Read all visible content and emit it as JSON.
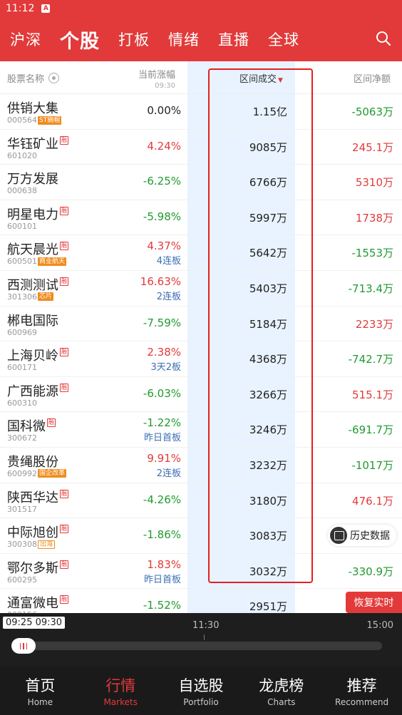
{
  "status_bar": {
    "time": "11:12",
    "badge": "A"
  },
  "top_nav": {
    "tabs": [
      {
        "label": "沪深",
        "active": false
      },
      {
        "label": "个股",
        "active": true
      },
      {
        "label": "打板",
        "active": false
      },
      {
        "label": "情绪",
        "active": false
      },
      {
        "label": "直播",
        "active": false
      },
      {
        "label": "全球",
        "active": false
      }
    ]
  },
  "columns": {
    "name": "股票名称",
    "change": "当前涨幅",
    "change_time": "09:30",
    "volume": "区间成交",
    "net": "区间净额"
  },
  "rows": [
    {
      "name": "供销大集",
      "code": "000564",
      "rong": false,
      "tag": "ST摘帽",
      "tag_style": "solid",
      "change": "0.00%",
      "change_color": "black",
      "change_sub": "",
      "volume": "1.15亿",
      "net": "-5063万",
      "net_color": "green"
    },
    {
      "name": "华钰矿业",
      "code": "601020",
      "rong": true,
      "tag": "",
      "tag_style": "",
      "change": "4.24%",
      "change_color": "red",
      "change_sub": "",
      "volume": "9085万",
      "net": "245.1万",
      "net_color": "red"
    },
    {
      "name": "万方发展",
      "code": "000638",
      "rong": false,
      "tag": "",
      "tag_style": "",
      "change": "-6.25%",
      "change_color": "green",
      "change_sub": "",
      "volume": "6766万",
      "net": "5310万",
      "net_color": "red"
    },
    {
      "name": "明星电力",
      "code": "600101",
      "rong": true,
      "tag": "",
      "tag_style": "",
      "change": "-5.98%",
      "change_color": "green",
      "change_sub": "",
      "volume": "5997万",
      "net": "1738万",
      "net_color": "red"
    },
    {
      "name": "航天晨光",
      "code": "600501",
      "rong": true,
      "tag": "商业航天",
      "tag_style": "solid",
      "change": "4.37%",
      "change_color": "red",
      "change_sub": "4连板",
      "volume": "5642万",
      "net": "-1553万",
      "net_color": "green"
    },
    {
      "name": "西测测试",
      "code": "301306",
      "rong": true,
      "tag": "芯片",
      "tag_style": "solid",
      "change": "16.63%",
      "change_color": "red",
      "change_sub": "2连板",
      "volume": "5403万",
      "net": "-713.4万",
      "net_color": "green"
    },
    {
      "name": "郴电国际",
      "code": "600969",
      "rong": false,
      "tag": "",
      "tag_style": "",
      "change": "-7.59%",
      "change_color": "green",
      "change_sub": "",
      "volume": "5184万",
      "net": "2233万",
      "net_color": "red"
    },
    {
      "name": "上海贝岭",
      "code": "600171",
      "rong": true,
      "tag": "",
      "tag_style": "",
      "change": "2.38%",
      "change_color": "red",
      "change_sub": "3天2板",
      "volume": "4368万",
      "net": "-742.7万",
      "net_color": "green"
    },
    {
      "name": "广西能源",
      "code": "600310",
      "rong": true,
      "tag": "",
      "tag_style": "",
      "change": "-6.03%",
      "change_color": "green",
      "change_sub": "",
      "volume": "3266万",
      "net": "515.1万",
      "net_color": "red"
    },
    {
      "name": "国科微",
      "code": "300672",
      "rong": true,
      "tag": "",
      "tag_style": "",
      "change": "-1.22%",
      "change_color": "green",
      "change_sub": "昨日首板",
      "volume": "3246万",
      "net": "-691.7万",
      "net_color": "green"
    },
    {
      "name": "贵绳股份",
      "code": "600992",
      "rong": false,
      "tag": "国企改革",
      "tag_style": "solid",
      "change": "9.91%",
      "change_color": "red",
      "change_sub": "2连板",
      "volume": "3232万",
      "net": "-1017万",
      "net_color": "green"
    },
    {
      "name": "陕西华达",
      "code": "301517",
      "rong": true,
      "tag": "",
      "tag_style": "",
      "change": "-4.26%",
      "change_color": "green",
      "change_sub": "",
      "volume": "3180万",
      "net": "476.1万",
      "net_color": "red"
    },
    {
      "name": "中际旭创",
      "code": "300308",
      "rong": true,
      "tag": "出海",
      "tag_style": "outline",
      "change": "-1.86%",
      "change_color": "green",
      "change_sub": "",
      "volume": "3083万",
      "net": "",
      "net_color": "green"
    },
    {
      "name": "鄂尔多斯",
      "code": "600295",
      "rong": true,
      "tag": "",
      "tag_style": "",
      "change": "1.83%",
      "change_color": "red",
      "change_sub": "昨日首板",
      "volume": "3032万",
      "net": "-330.9万",
      "net_color": "green"
    },
    {
      "name": "通富微电",
      "code": "002156",
      "rong": true,
      "tag": "",
      "tag_style": "",
      "change": "-1.52%",
      "change_color": "green",
      "change_sub": "",
      "volume": "2951万",
      "net": "",
      "net_color": "green"
    }
  ],
  "floating": {
    "history": "历史数据",
    "restore": "恢复实时"
  },
  "timeline": {
    "start": "09:25",
    "current": "09:30",
    "mid": "11:30",
    "end": "15:00"
  },
  "bottom_nav": [
    {
      "zh": "首页",
      "en": "Home",
      "active": false
    },
    {
      "zh": "行情",
      "en": "Markets",
      "active": true
    },
    {
      "zh": "自选股",
      "en": "Portfolio",
      "active": false
    },
    {
      "zh": "龙虎榜",
      "en": "Charts",
      "active": false
    },
    {
      "zh": "推荐",
      "en": "Recommend",
      "active": false
    }
  ],
  "colors": {
    "brand": "#e23a3a",
    "up": "#e23a3a",
    "down": "#1f9a2e",
    "highlight": "#e8f3ff"
  }
}
